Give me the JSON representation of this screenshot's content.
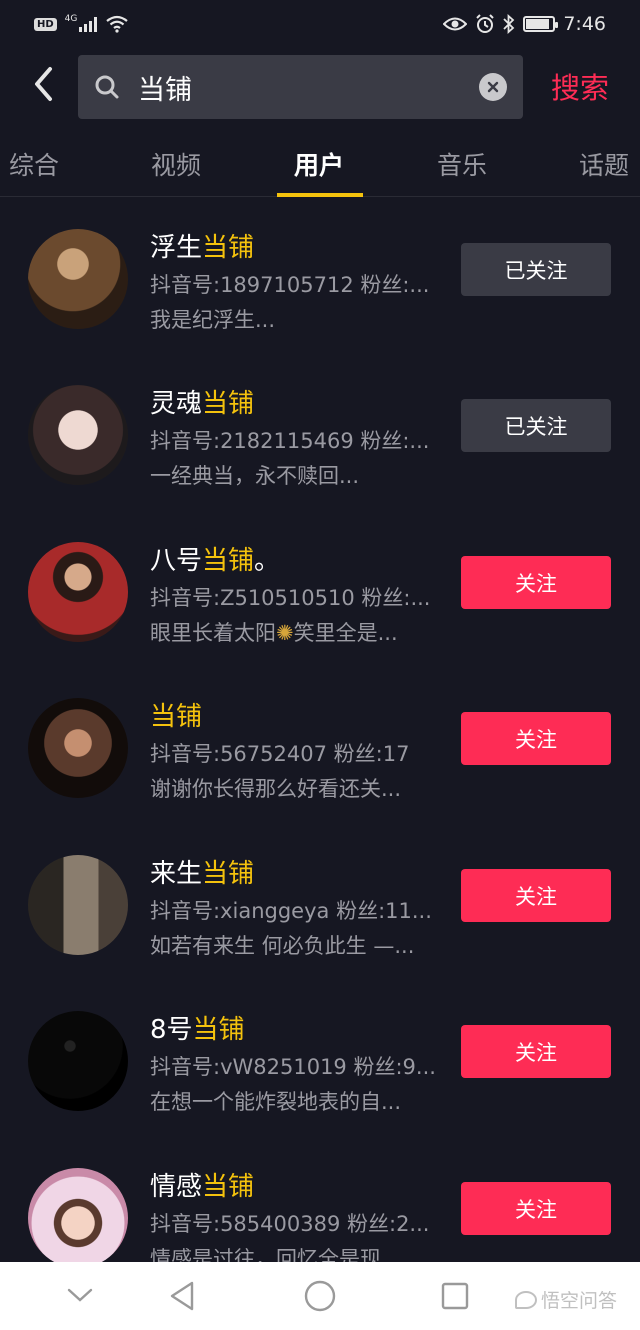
{
  "status_bar": {
    "hd": "HD",
    "network": "4G",
    "time": "7:46"
  },
  "search": {
    "query": "当铺",
    "submit_label": "搜索"
  },
  "tabs": [
    {
      "label": "综合"
    },
    {
      "label": "视频"
    },
    {
      "label": "用户"
    },
    {
      "label": "音乐"
    },
    {
      "label": "话题"
    }
  ],
  "active_tab": "用户",
  "users": [
    {
      "name_prefix": "浮生",
      "name_highlight": "当铺",
      "name_suffix": "",
      "id_line": "抖音号:1897105712 粉丝:...",
      "bio": "我是纪浮生...",
      "button": "已关注",
      "followed": true,
      "avatar_colors": [
        "#6b4a2e",
        "#2b1d14"
      ]
    },
    {
      "name_prefix": "灵魂",
      "name_highlight": "当铺",
      "name_suffix": "",
      "id_line": "抖音号:2182115469 粉丝:...",
      "bio": "一经典当，永不赎回...",
      "button": "已关注",
      "followed": true,
      "avatar_colors": [
        "#d8c7c2",
        "#1d1a1c"
      ]
    },
    {
      "name_prefix": "八号",
      "name_highlight": "当铺",
      "name_suffix": "。",
      "id_line": "抖音号:Z510510510 粉丝:...",
      "bio_before_emoji": "眼里长着太阳",
      "bio_after_emoji": "笑里全是...",
      "button": "关注",
      "followed": false,
      "avatar_colors": [
        "#a82a2a",
        "#3a1a18"
      ]
    },
    {
      "name_prefix": "",
      "name_highlight": "当铺",
      "name_suffix": "",
      "id_line": "抖音号:56752407 粉丝:17",
      "bio": "谢谢你长得那么好看还关...",
      "button": "关注",
      "followed": false,
      "avatar_colors": [
        "#5a3a2c",
        "#120c0a"
      ]
    },
    {
      "name_prefix": "来生",
      "name_highlight": "当铺",
      "name_suffix": "",
      "id_line": "抖音号:xianggeya 粉丝:11...",
      "bio": "如若有来生 何必负此生 —...",
      "button": "关注",
      "followed": false,
      "avatar_colors": [
        "#8a7d6e",
        "#2a2622"
      ]
    },
    {
      "name_prefix": "8号",
      "name_highlight": "当铺",
      "name_suffix": "",
      "id_line": "抖音号:vW8251019 粉丝:9...",
      "bio": "在想一个能炸裂地表的自...",
      "button": "关注",
      "followed": false,
      "avatar_colors": [
        "#080808",
        "#000000"
      ]
    },
    {
      "name_prefix": "情感",
      "name_highlight": "当铺",
      "name_suffix": "",
      "id_line": "抖音号:585400389 粉丝:2...",
      "bio": "情感是过往，回忆全是现...",
      "button": "关注",
      "followed": false,
      "avatar_colors": [
        "#f0d6e6",
        "#c98aa8"
      ]
    }
  ],
  "watermark": "悟空问答",
  "colors": {
    "background": "#161722",
    "accent_red": "#fe2c55",
    "highlight_yellow": "#f4c20d",
    "muted_text": "#9a9aa2",
    "followed_button": "#3a3b45"
  }
}
